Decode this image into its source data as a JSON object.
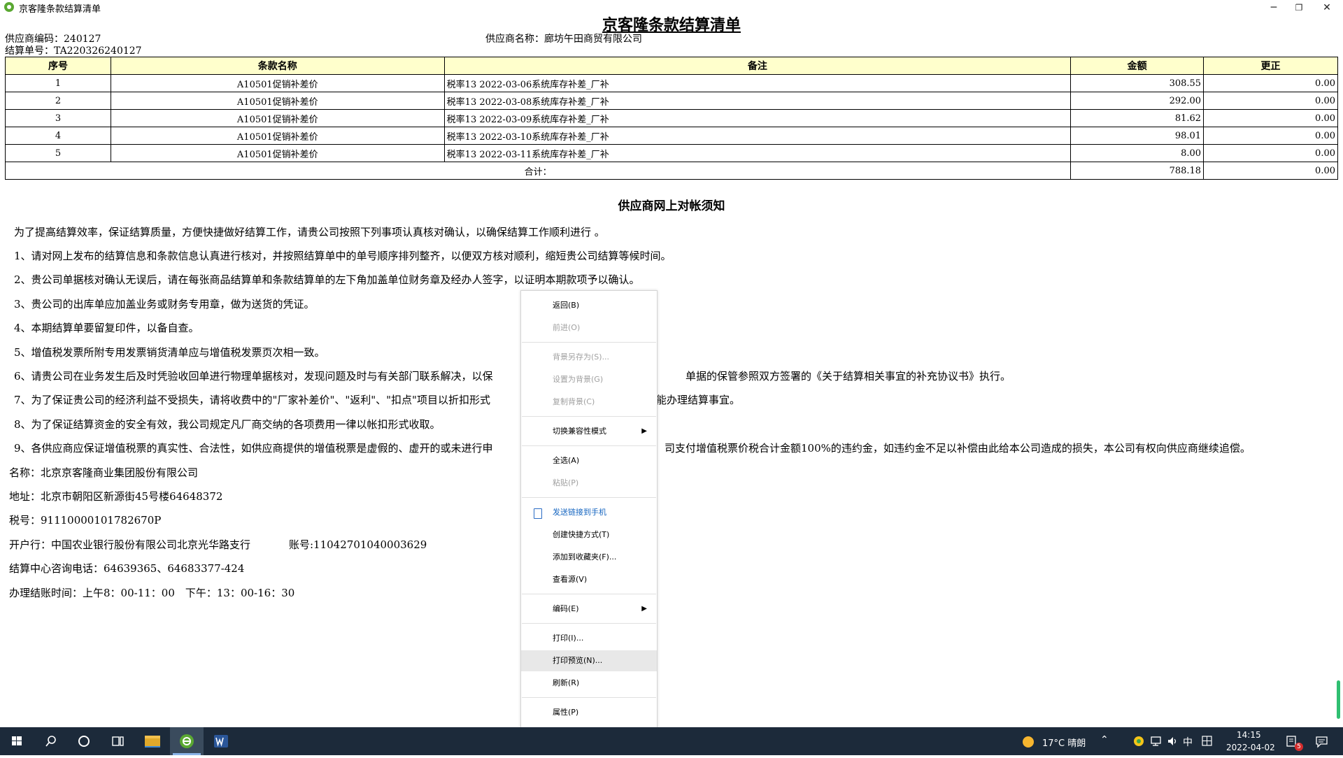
{
  "window": {
    "title": "京客隆条款结算清单",
    "minimize": "─",
    "restore": "❐",
    "close": "✕"
  },
  "document": {
    "title": "京客隆条款结算清单",
    "supplier_code": "供应商编码：240127",
    "supplier_name": "供应商名称：廊坊午田商贸有限公司",
    "settlement_no": "结算单号：TA220326240127"
  },
  "table": {
    "headers": [
      "序号",
      "条款名称",
      "备注",
      "金额",
      "更正"
    ],
    "rows": [
      [
        "1",
        "A10501促销补差价",
        "税率13 2022-03-06系统库存补差_厂补",
        "308.55",
        "0.00"
      ],
      [
        "2",
        "A10501促销补差价",
        "税率13 2022-03-08系统库存补差_厂补",
        "292.00",
        "0.00"
      ],
      [
        "3",
        "A10501促销补差价",
        "税率13 2022-03-09系统库存补差_厂补",
        "81.62",
        "0.00"
      ],
      [
        "4",
        "A10501促销补差价",
        "税率13 2022-03-10系统库存补差_厂补",
        "98.01",
        "0.00"
      ],
      [
        "5",
        "A10501促销补差价",
        "税率13 2022-03-11系统库存补差_厂补",
        "8.00",
        "0.00"
      ]
    ],
    "total_label": "合计：",
    "total_amount": "788.18",
    "total_correction": "0.00"
  },
  "notice": {
    "title": "供应商网上对帐须知",
    "paragraphs": [
      "为了提高结算效率，保证结算质量，方便快捷做好结算工作，请贵公司按照下列事项认真核对确认，以确保结算工作顺利进行 。",
      "1、请对网上发布的结算信息和条款信息认真进行核对，并按照结算单中的单号顺序排列整齐，以便双方核对顺利，缩短贵公司结算等候时间。",
      "2、贵公司单据核对确认无误后，请在每张商品结算单和条款结算单的左下角加盖单位财务章及经办人签字，以证明本期款项予以确认。",
      "3、贵公司的出库单应加盖业务或财务专用章，做为送货的凭证。",
      "4、本期结算单要留复印件，以备自查。",
      "5、增值税发票所附专用发票销货清单应与增值税发票页次相一致。",
      "6、请贵公司在业务发生后及时凭验收回单进行物理单据核对，发现问题及时与有关部门联系解决，以保",
      "7、为了保证贵公司的经济利益不受损失，请将收费中的\"厂家补差价\"、\"返利\"、\"扣点\"项目以折扣形式",
      "8、为了保证结算资金的安全有效，我公司规定凡厂商交纳的各项费用一律以帐扣形式收取。",
      "9、各供应商应保证增值税票的真实性、合法性，如供应商提供的增值税票是虚假的、虚开的或未进行申"
    ],
    "para6_tail": "单据的保管参照双方签署的《关于结算相关事宜的补充协议书》执行。",
    "para7_tail": "能办理结算事宜。",
    "para9_tail": "司支付增值税票价税合计金额100%的违约金，如违约金不足以补偿由此给本公司造成的损失，本公司有权向供应商继续追偿。"
  },
  "company": {
    "name": "名称：北京京客隆商业集团股份有限公司",
    "address": "地址：北京市朝阳区新源街45号楼64648372",
    "tax_no": "税号：91110000101782670P",
    "bank": "开户行：中国农业银行股份有限公司北京光华路支行",
    "account": "账号:11042701040003629",
    "phone": "结算中心咨询电话：64639365、64683377-424",
    "hours": "办理结账时间：上午8：00-11：00　下午：13：00-16：30"
  },
  "context_menu": {
    "back": "返回(B)",
    "forward": "前进(O)",
    "save_bg": "背景另存为(S)...",
    "set_bg": "设置为背景(G)",
    "copy_bg": "复制背景(C)",
    "compat": "切换兼容性模式",
    "select_all": "全选(A)",
    "paste": "粘贴(P)",
    "send_phone": "发送链接到手机",
    "shortcut": "创建快捷方式(T)",
    "favorites": "添加到收藏夹(F)...",
    "view_source": "查看源(V)",
    "encoding": "编码(E)",
    "print": "打印(I)...",
    "print_preview": "打印预览(N)...",
    "refresh": "刷新(R)",
    "properties": "属性(P)"
  },
  "taskbar": {
    "weather": "17°C 晴朗",
    "ime": "中",
    "time": "14:15",
    "date": "2022-04-02",
    "notification_count": "5"
  },
  "colors": {
    "table_header_bg": "#ffffcc",
    "taskbar_bg": "#1c2a3a",
    "menu_highlight": "#e8e8e8",
    "scroll_thumb": "#2fbf71"
  }
}
